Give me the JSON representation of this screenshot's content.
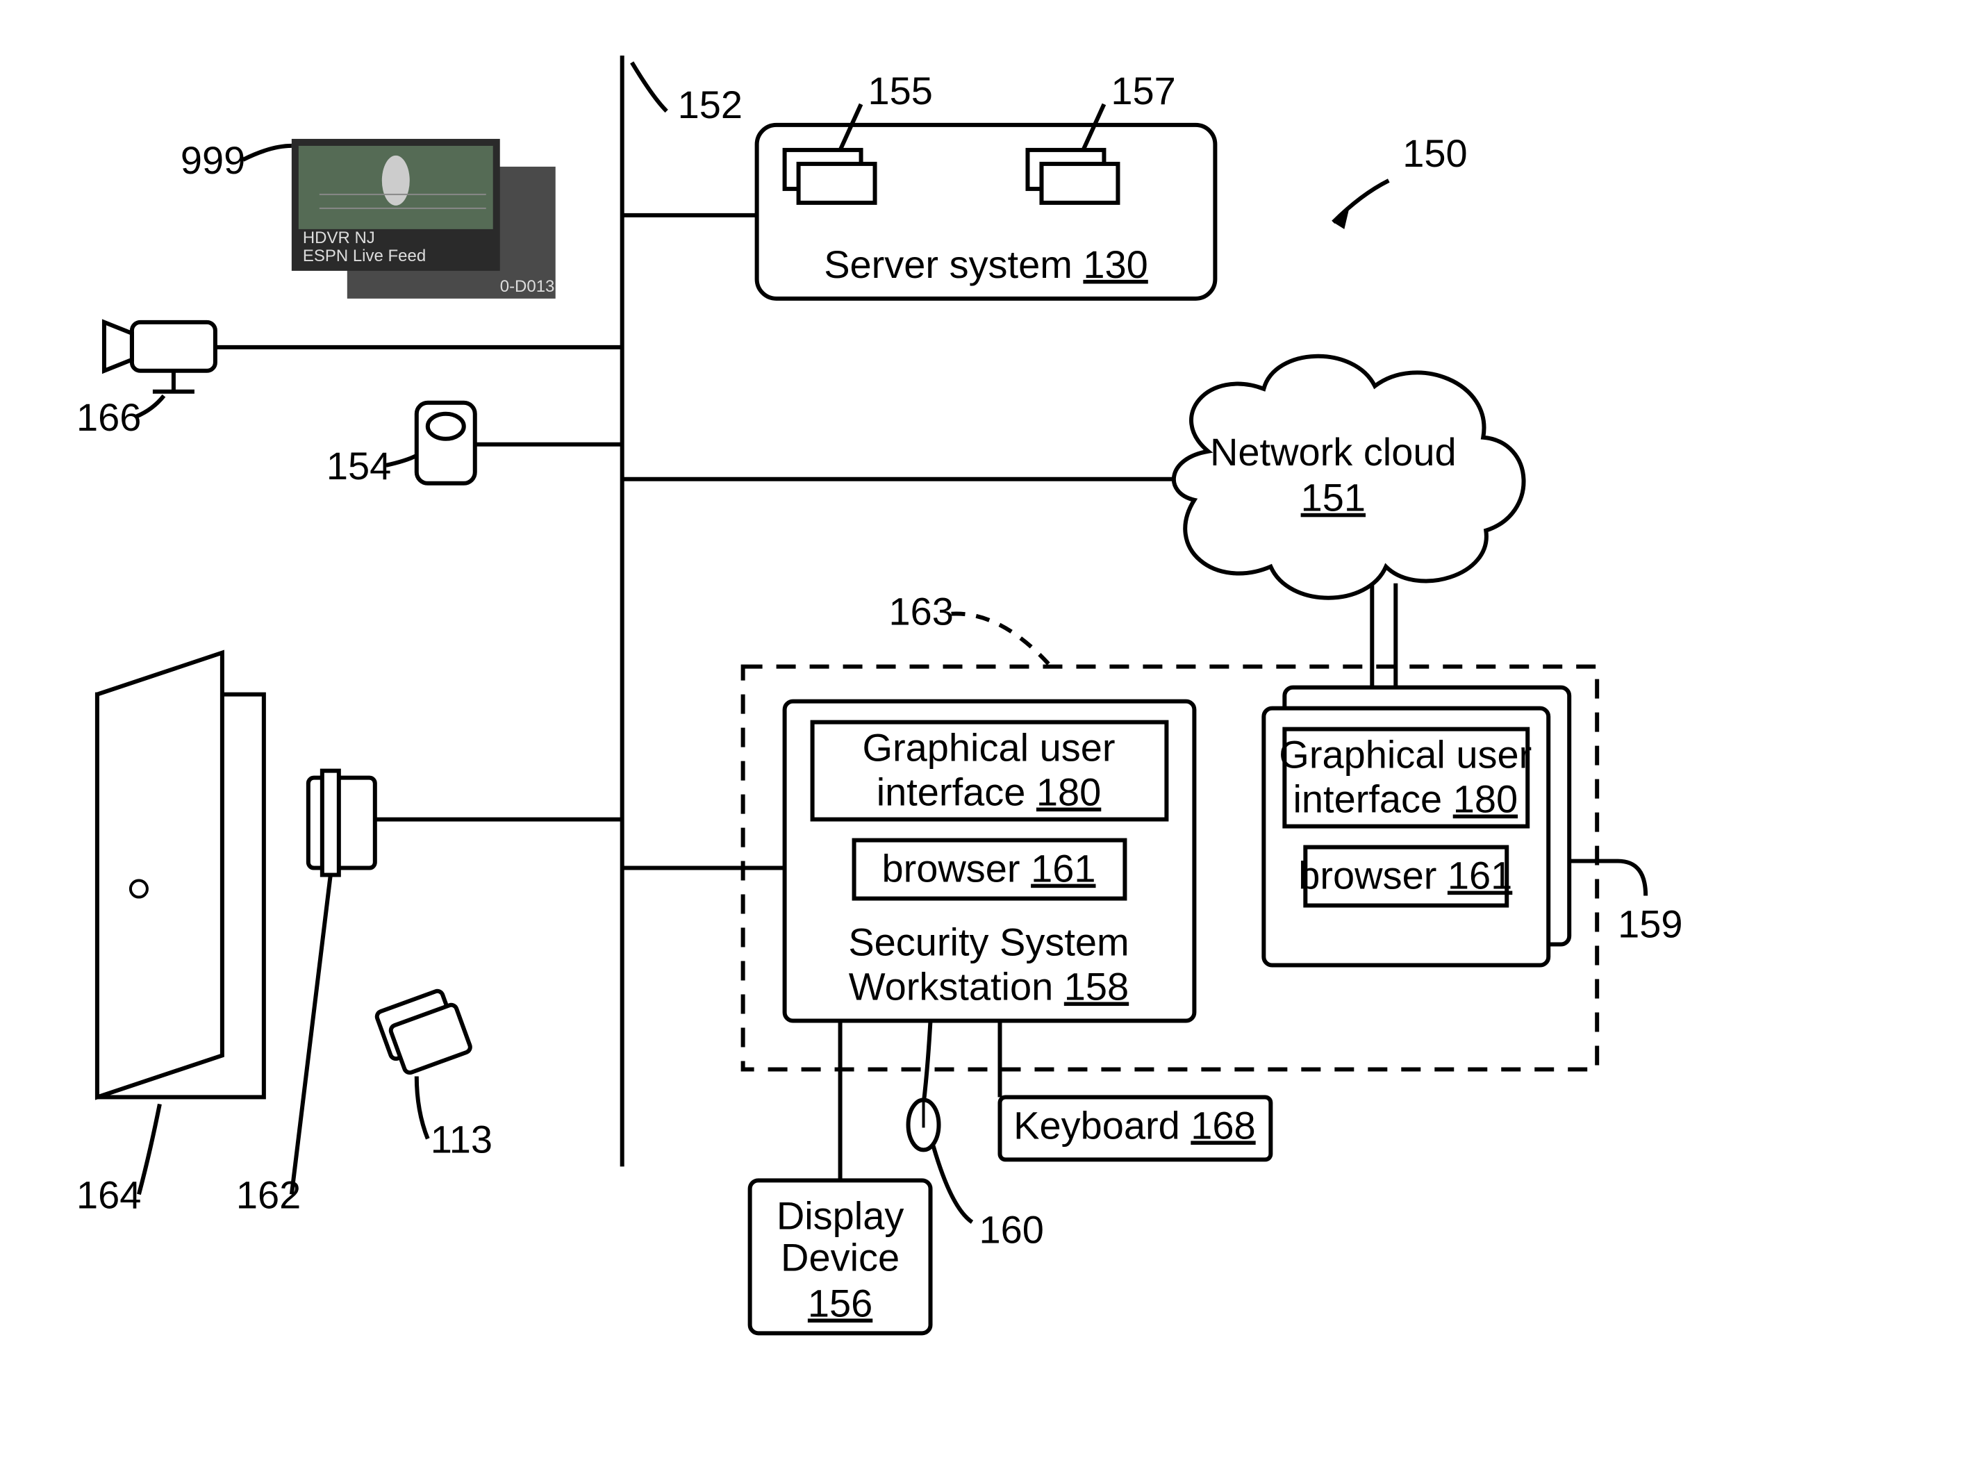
{
  "refs": {
    "r999": "999",
    "r152": "152",
    "r155": "155",
    "r157": "157",
    "r150": "150",
    "r166": "166",
    "r154": "154",
    "r151": "151",
    "r163": "163",
    "r162": "162",
    "r164": "164",
    "r113": "113",
    "r159": "159",
    "r160": "160"
  },
  "video_overlay": {
    "line1": "HDVR NJ",
    "line2": "ESPN Live Feed",
    "line3": "0-D013"
  },
  "server": {
    "label": "Server system ",
    "num": "130"
  },
  "cloud": {
    "line1": "Network cloud",
    "num": "151"
  },
  "ws": {
    "gui": "Graphical user",
    "gui2": "interface ",
    "gnum": "180",
    "browser": "browser ",
    "bnum": "161",
    "s1": "Security System",
    "s2": "Workstation ",
    "snum": "158"
  },
  "client2": {
    "gui": "Graphical user",
    "gui2": "interface ",
    "gnum": "180",
    "browser": "browser ",
    "bnum": "161"
  },
  "kb": {
    "label": "Keyboard ",
    "num": "168"
  },
  "disp": {
    "line1": "Display",
    "line2": "Device",
    "num": "156"
  }
}
